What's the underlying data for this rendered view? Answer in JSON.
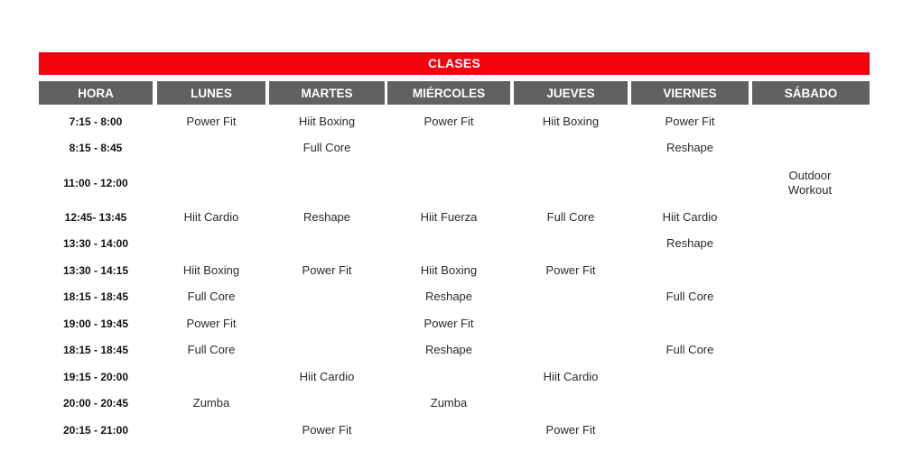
{
  "title": "CLASES",
  "headers": [
    "HORA",
    "LUNES",
    "MARTES",
    "MIÉRCOLES",
    "JUEVES",
    "VIERNES",
    "SÁBADO"
  ],
  "rows": [
    {
      "time": "7:15 - 8:00",
      "lunes": "Power Fit",
      "martes": "Hiit Boxing",
      "miercoles": "Power Fit",
      "jueves": "Hiit Boxing",
      "viernes": "Power Fit",
      "sabado": ""
    },
    {
      "time": "8:15 - 8:45",
      "lunes": "",
      "martes": "Full Core",
      "miercoles": "",
      "jueves": "",
      "viernes": "Reshape",
      "sabado": ""
    },
    {
      "time": "11:00 - 12:00",
      "lunes": "",
      "martes": "",
      "miercoles": "",
      "jueves": "",
      "viernes": "",
      "sabado": "Outdoor Workout"
    },
    {
      "time": "12:45- 13:45",
      "lunes": "Hiit Cardio",
      "martes": "Reshape",
      "miercoles": "Hiit Fuerza",
      "jueves": "Full Core",
      "viernes": "Hiit Cardio",
      "sabado": ""
    },
    {
      "time": "13:30 - 14:00",
      "lunes": "",
      "martes": "",
      "miercoles": "",
      "jueves": "",
      "viernes": "Reshape",
      "sabado": ""
    },
    {
      "time": "13:30 - 14:15",
      "lunes": "Hiit Boxing",
      "martes": "Power Fit",
      "miercoles": "Hiit Boxing",
      "jueves": "Power Fit",
      "viernes": "",
      "sabado": ""
    },
    {
      "time": "18:15 - 18:45",
      "lunes": "Full Core",
      "martes": "",
      "miercoles": "Reshape",
      "jueves": "",
      "viernes": "Full Core",
      "sabado": ""
    },
    {
      "time": "19:00 - 19:45",
      "lunes": "Power Fit",
      "martes": "",
      "miercoles": "Power Fit",
      "jueves": "",
      "viernes": "",
      "sabado": ""
    },
    {
      "time": "18:15 - 18:45",
      "lunes": "Full Core",
      "martes": "",
      "miercoles": "Reshape",
      "jueves": "",
      "viernes": "Full Core",
      "sabado": ""
    },
    {
      "time": "19:15 - 20:00",
      "lunes": "",
      "martes": "Hiit Cardio",
      "miercoles": "",
      "jueves": "Hiit Cardio",
      "viernes": "",
      "sabado": ""
    },
    {
      "time": "20:00 - 20:45",
      "lunes": "Zumba",
      "martes": "",
      "miercoles": "Zumba",
      "jueves": "",
      "viernes": "",
      "sabado": ""
    },
    {
      "time": "20:15 - 21:00",
      "lunes": "",
      "martes": "Power Fit",
      "miercoles": "",
      "jueves": "Power Fit",
      "viernes": "",
      "sabado": ""
    }
  ],
  "colors": {
    "title_bar": "#f5000f",
    "header_bg": "#616161",
    "header_text": "#ffffff"
  }
}
